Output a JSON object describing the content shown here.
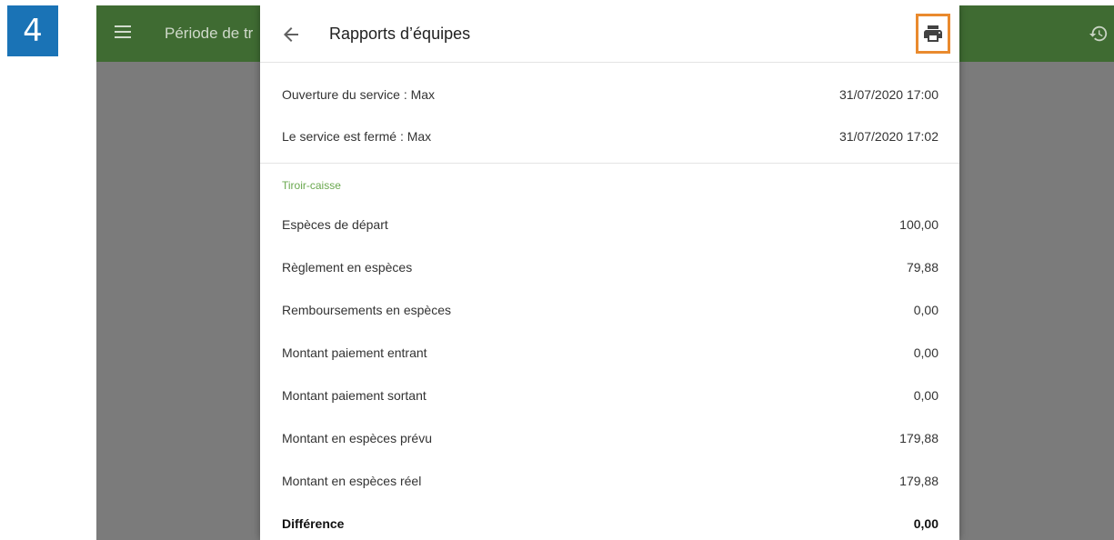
{
  "step_number": "4",
  "app_bar": {
    "title": "Période de tr",
    "menu_icon": "hamburger-menu-icon",
    "history_icon": "history-icon"
  },
  "dialog": {
    "title": "Rapports d’équipes",
    "back_icon": "arrow-back-icon",
    "print_icon": "printer-icon",
    "highlight_color": "#e98a2e",
    "service_rows": [
      {
        "label": "Ouverture du service : Max",
        "value": "31/07/2020 17:00"
      },
      {
        "label": "Le service est fermé : Max",
        "value": "31/07/2020 17:02"
      }
    ],
    "cash_section": {
      "label": "Tiroir-caisse",
      "label_color": "#6aa84f",
      "rows": [
        {
          "label": "Espèces de départ",
          "value": "100,00"
        },
        {
          "label": "Règlement en espèces",
          "value": "79,88"
        },
        {
          "label": "Remboursements en espèces",
          "value": "0,00"
        },
        {
          "label": "Montant paiement entrant",
          "value": "0,00"
        },
        {
          "label": "Montant paiement sortant",
          "value": "0,00"
        },
        {
          "label": "Montant en espèces prévu",
          "value": "179,88"
        },
        {
          "label": "Montant en espèces réel",
          "value": "179,88"
        }
      ],
      "difference": {
        "label": "Différence",
        "value": "0,00"
      }
    }
  },
  "colors": {
    "toolbar": "#3f6b32",
    "badge": "#1a73b6",
    "scrim": "#7b7b7b"
  }
}
